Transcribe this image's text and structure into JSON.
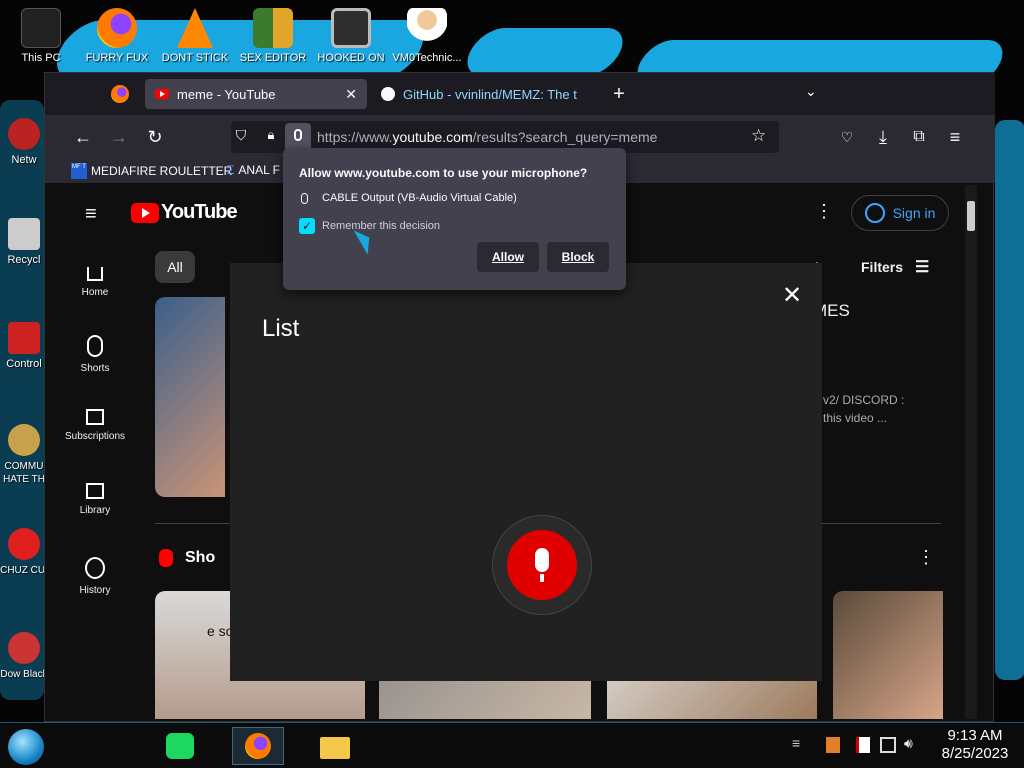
{
  "desktop": {
    "top_icons": [
      {
        "label": "This PC"
      },
      {
        "label": "FURRY FUX"
      },
      {
        "label": "DONT STICK"
      },
      {
        "label": "SEX EDITOR"
      },
      {
        "label": "HOOKED ON"
      },
      {
        "label": "VM0Technic..."
      }
    ],
    "left_icons": [
      {
        "label": "Netw"
      },
      {
        "label": "Recycl"
      },
      {
        "label": "Control"
      },
      {
        "label": "COMMU HATE TH"
      },
      {
        "label": "CHUZ CUI"
      },
      {
        "label": "Dow Black"
      }
    ]
  },
  "browser": {
    "tabs": [
      {
        "title": "meme - YouTube",
        "active": true
      },
      {
        "title": "GitHub - vvinlind/MEMZ: The t",
        "active": false
      }
    ],
    "new_tab": "+",
    "url_prefix": "https://www.",
    "url_domain": "youtube.com",
    "url_rest": "/results?search_query=meme",
    "bookmarks": [
      {
        "badge": "MF T",
        "label": "MEDIAFIRE ROULETTER"
      },
      {
        "label": "ANAL F"
      }
    ]
  },
  "permission_popup": {
    "title": "Allow www.youtube.com to use your microphone?",
    "device": "CABLE Output (VB-Audio Virtual Cable)",
    "remember_label": "Remember this decision",
    "remember_checked": true,
    "allow_label": "Allow",
    "block_label": "Block"
  },
  "youtube": {
    "logo_text": "YouTube",
    "sign_in": "Sign in",
    "chip_all": "All",
    "filters": "Filters",
    "sidebar": [
      {
        "label": "Home",
        "icon": "home-icon"
      },
      {
        "label": "Shorts",
        "icon": "shorts-icon"
      },
      {
        "label": "Subscriptions",
        "icon": "subscriptions-icon"
      },
      {
        "label": "Library",
        "icon": "library-icon"
      },
      {
        "label": "History",
        "icon": "history-icon"
      }
    ],
    "voice_dialog_title": "List",
    "result_fragment_title": "MES",
    "result_fragment_desc1": "n.v2/ DISCORD :",
    "result_fragment_desc2": "g this video ...",
    "shorts_heading": "Sho",
    "short_caption": "e so many questions",
    "short_caption_emoji": "💀💀"
  },
  "taskbar": {
    "time": "9:13 AM",
    "date": "8/25/2023"
  },
  "colors": {
    "accent": "#1aa7e0",
    "yt_red": "#ff0000",
    "mic_red": "#e00000",
    "firefox_panel": "#42414d",
    "sign_in_blue": "#3ea6ff"
  }
}
